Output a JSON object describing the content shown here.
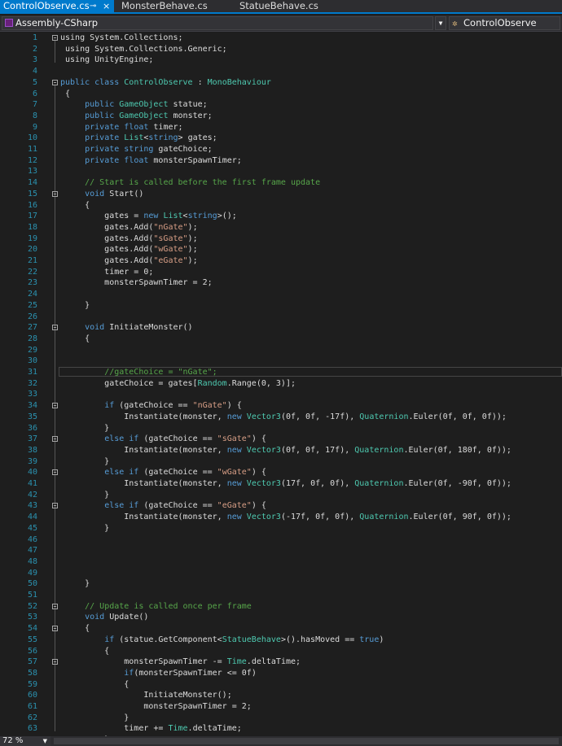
{
  "tabs": [
    {
      "label": "ControlObserve.cs",
      "pin": "⊸",
      "close": "×"
    },
    {
      "label": "MonsterBehave.cs"
    },
    {
      "label": "StatueBehave.cs"
    }
  ],
  "nav": {
    "project": "Assembly-CSharp",
    "class": "ControlObserve",
    "project_icon": "csharp-project-icon",
    "class_icon": "class-icon"
  },
  "zoom": "72 %",
  "current_line": 31,
  "lines": [
    [
      [
        null,
        "using System.Collections;"
      ]
    ],
    [
      [
        null,
        " using System.Collections.Generic;"
      ]
    ],
    [
      [
        null,
        " using UnityEngine;"
      ]
    ],
    [],
    [
      [
        "kw",
        "public class "
      ],
      [
        "ty",
        "ControlObserve"
      ],
      [
        null,
        " : "
      ],
      [
        "ty",
        "MonoBehaviour"
      ]
    ],
    [
      [
        null,
        " {"
      ]
    ],
    [
      [
        null,
        "     "
      ],
      [
        "kw",
        "public "
      ],
      [
        "ty",
        "GameObject"
      ],
      [
        null,
        " statue;"
      ]
    ],
    [
      [
        null,
        "     "
      ],
      [
        "kw",
        "public "
      ],
      [
        "ty",
        "GameObject"
      ],
      [
        null,
        " monster;"
      ]
    ],
    [
      [
        null,
        "     "
      ],
      [
        "kw",
        "private float"
      ],
      [
        null,
        " timer;"
      ]
    ],
    [
      [
        null,
        "     "
      ],
      [
        "kw",
        "private "
      ],
      [
        "ty",
        "List"
      ],
      [
        null,
        "<"
      ],
      [
        "kw",
        "string"
      ],
      [
        null,
        "> gates;"
      ]
    ],
    [
      [
        null,
        "     "
      ],
      [
        "kw",
        "private string"
      ],
      [
        null,
        " gateChoice;"
      ]
    ],
    [
      [
        null,
        "     "
      ],
      [
        "kw",
        "private float"
      ],
      [
        null,
        " monsterSpawnTimer;"
      ]
    ],
    [],
    [
      [
        null,
        "     "
      ],
      [
        "cm",
        "// Start is called before the first frame update"
      ]
    ],
    [
      [
        null,
        "     "
      ],
      [
        "kw",
        "void "
      ],
      [
        null,
        "Start()"
      ]
    ],
    [
      [
        null,
        "     {"
      ]
    ],
    [
      [
        null,
        "         gates = "
      ],
      [
        "kw",
        "new "
      ],
      [
        "ty",
        "List"
      ],
      [
        null,
        "<"
      ],
      [
        "kw",
        "string"
      ],
      [
        null,
        ">();"
      ]
    ],
    [
      [
        null,
        "         gates.Add("
      ],
      [
        "st",
        "\"nGate\""
      ],
      [
        null,
        ");"
      ]
    ],
    [
      [
        null,
        "         gates.Add("
      ],
      [
        "st",
        "\"sGate\""
      ],
      [
        null,
        ");"
      ]
    ],
    [
      [
        null,
        "         gates.Add("
      ],
      [
        "st",
        "\"wGate\""
      ],
      [
        null,
        ");"
      ]
    ],
    [
      [
        null,
        "         gates.Add("
      ],
      [
        "st",
        "\"eGate\""
      ],
      [
        null,
        ");"
      ]
    ],
    [
      [
        null,
        "         timer = 0;"
      ]
    ],
    [
      [
        null,
        "         monsterSpawnTimer = 2;"
      ]
    ],
    [],
    [
      [
        null,
        "     }"
      ]
    ],
    [],
    [
      [
        null,
        "     "
      ],
      [
        "kw",
        "void "
      ],
      [
        null,
        "InitiateMonster()"
      ]
    ],
    [
      [
        null,
        "     {"
      ]
    ],
    [],
    [],
    [
      [
        null,
        "         "
      ],
      [
        "cm",
        "//gateChoice = \"nGate\";"
      ]
    ],
    [
      [
        null,
        "         gateChoice = gates["
      ],
      [
        "ty",
        "Random"
      ],
      [
        null,
        ".Range(0, 3)];"
      ]
    ],
    [],
    [
      [
        null,
        "         "
      ],
      [
        "kw",
        "if "
      ],
      [
        null,
        "(gateChoice == "
      ],
      [
        "st",
        "\"nGate\""
      ],
      [
        null,
        ") {"
      ]
    ],
    [
      [
        null,
        "             Instantiate(monster, "
      ],
      [
        "kw",
        "new "
      ],
      [
        "ty",
        "Vector3"
      ],
      [
        null,
        "(0f, 0f, -17f), "
      ],
      [
        "ty",
        "Quaternion"
      ],
      [
        null,
        ".Euler(0f, 0f, 0f));"
      ]
    ],
    [
      [
        null,
        "         }"
      ]
    ],
    [
      [
        null,
        "         "
      ],
      [
        "kw",
        "else if "
      ],
      [
        null,
        "(gateChoice == "
      ],
      [
        "st",
        "\"sGate\""
      ],
      [
        null,
        ") {"
      ]
    ],
    [
      [
        null,
        "             Instantiate(monster, "
      ],
      [
        "kw",
        "new "
      ],
      [
        "ty",
        "Vector3"
      ],
      [
        null,
        "(0f, 0f, 17f), "
      ],
      [
        "ty",
        "Quaternion"
      ],
      [
        null,
        ".Euler(0f, 180f, 0f));"
      ]
    ],
    [
      [
        null,
        "         }"
      ]
    ],
    [
      [
        null,
        "         "
      ],
      [
        "kw",
        "else if "
      ],
      [
        null,
        "(gateChoice == "
      ],
      [
        "st",
        "\"wGate\""
      ],
      [
        null,
        ") {"
      ]
    ],
    [
      [
        null,
        "             Instantiate(monster, "
      ],
      [
        "kw",
        "new "
      ],
      [
        "ty",
        "Vector3"
      ],
      [
        null,
        "(17f, 0f, 0f), "
      ],
      [
        "ty",
        "Quaternion"
      ],
      [
        null,
        ".Euler(0f, -90f, 0f));"
      ]
    ],
    [
      [
        null,
        "         }"
      ]
    ],
    [
      [
        null,
        "         "
      ],
      [
        "kw",
        "else if "
      ],
      [
        null,
        "(gateChoice == "
      ],
      [
        "st",
        "\"eGate\""
      ],
      [
        null,
        ") {"
      ]
    ],
    [
      [
        null,
        "             Instantiate(monster, "
      ],
      [
        "kw",
        "new "
      ],
      [
        "ty",
        "Vector3"
      ],
      [
        null,
        "(-17f, 0f, 0f), "
      ],
      [
        "ty",
        "Quaternion"
      ],
      [
        null,
        ".Euler(0f, 90f, 0f));"
      ]
    ],
    [
      [
        null,
        "         }"
      ]
    ],
    [],
    [],
    [],
    [],
    [
      [
        null,
        "     }"
      ]
    ],
    [],
    [
      [
        null,
        "     "
      ],
      [
        "cm",
        "// Update is called once per frame"
      ]
    ],
    [
      [
        null,
        "     "
      ],
      [
        "kw",
        "void "
      ],
      [
        null,
        "Update()"
      ]
    ],
    [
      [
        null,
        "     {"
      ]
    ],
    [
      [
        null,
        "         "
      ],
      [
        "kw",
        "if "
      ],
      [
        null,
        "(statue.GetComponent<"
      ],
      [
        "ty",
        "StatueBehave"
      ],
      [
        null,
        ">().hasMoved == "
      ],
      [
        "kw",
        "true"
      ],
      [
        null,
        ")"
      ]
    ],
    [
      [
        null,
        "         {"
      ]
    ],
    [
      [
        null,
        "             monsterSpawnTimer -= "
      ],
      [
        "ty",
        "Time"
      ],
      [
        null,
        ".deltaTime;"
      ]
    ],
    [
      [
        null,
        "             "
      ],
      [
        "kw",
        "if"
      ],
      [
        null,
        "(monsterSpawnTimer <= 0f)"
      ]
    ],
    [
      [
        null,
        "             {"
      ]
    ],
    [
      [
        null,
        "                 InitiateMonster();"
      ]
    ],
    [
      [
        null,
        "                 monsterSpawnTimer = 2;"
      ]
    ],
    [
      [
        null,
        "             }"
      ]
    ],
    [
      [
        null,
        "             timer += "
      ],
      [
        "ty",
        "Time"
      ],
      [
        null,
        ".deltaTime;"
      ]
    ],
    [
      [
        null,
        "         }"
      ]
    ]
  ]
}
